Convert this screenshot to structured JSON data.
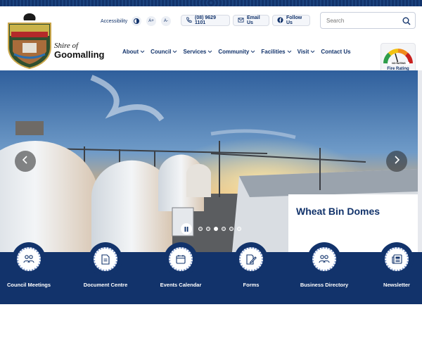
{
  "site": {
    "shire_of": "Shire of",
    "shire_name": "Goomalling",
    "logo_text": "SHIRE OF GOOMALLING"
  },
  "utility": {
    "accessibility_label": "Accessibility",
    "contrast_icon": "contrast-icon",
    "increase_text": "A+",
    "decrease_text": "A-",
    "phone": "(08) 9629 1101",
    "email": "Email Us",
    "follow": "Follow Us"
  },
  "search": {
    "placeholder": "Search"
  },
  "nav": [
    {
      "label": "About"
    },
    {
      "label": "Council"
    },
    {
      "label": "Services"
    },
    {
      "label": "Community"
    },
    {
      "label": "Facilities"
    },
    {
      "label": "Visit"
    },
    {
      "label": "Contact Us"
    }
  ],
  "fire": {
    "label": "Fire Rating",
    "gauge_text": "NO RATING"
  },
  "hero": {
    "caption_title": "Wheat Bin Domes",
    "slide_count": 6,
    "active_slide": 3
  },
  "quick_links": [
    {
      "label": "Council Meetings",
      "icon": "people-icon"
    },
    {
      "label": "Document Centre",
      "icon": "document-icon"
    },
    {
      "label": "Events Calendar",
      "icon": "calendar-icon"
    },
    {
      "label": "Forms",
      "icon": "form-edit-icon"
    },
    {
      "label": "Business Directory",
      "icon": "people-icon"
    },
    {
      "label": "Newsletter",
      "icon": "newsletter-icon"
    }
  ],
  "colors": {
    "primary": "#12336b",
    "accent": "#7f98c9"
  }
}
